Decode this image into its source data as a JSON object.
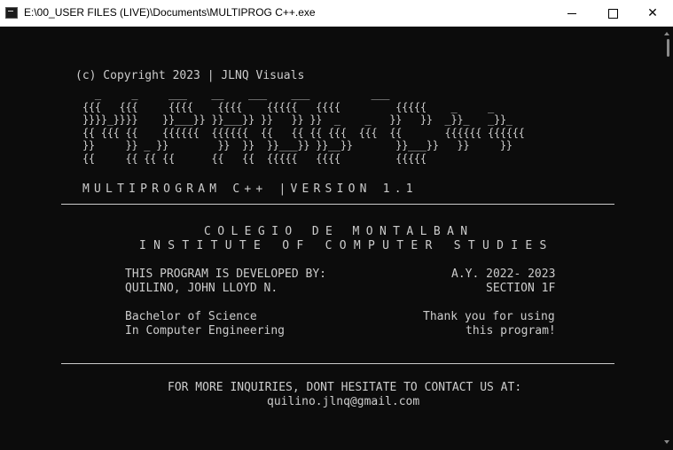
{
  "window": {
    "title": "E:\\00_USER FILES (LIVE)\\Documents\\MULTIPROG C++.exe",
    "minimize_label": "Minimize",
    "maximize_label": "Maximize",
    "close_label": "✕"
  },
  "console": {
    "copyright": "(c) Copyright 2023 | JLNQ Visuals",
    "ascii_logo": "  _     _     ___    __    ___    ___          ___\n{{{   {{{     {{{{    {{{{    {{{{{   {{{{         {{{{{    _     _\n}}}}_}}}}    }}___}} }}___}} }}   }} }}  _    _   }}   }}  _}}_   _}}_\n{{ {{{ {{    {{{{{{  {{{{{{  {{   {{ {{ {{{  {{{  {{       {{{{{{ {{{{{{\n}}     }} _ }}        }}  }}  }}___}} }}__}}       }}___}}   }}     }}\n{{     {{ {{ {{      {{   {{  {{{{{   {{{{         {{{{{",
    "program_line": "MULTIPROGRAM C++ |VERSION 1.1",
    "school": "COLEGIO DE MONTALBAN",
    "institute": "INSTITUTE OF COMPUTER STUDIES",
    "developed_by_label": "THIS PROGRAM IS DEVELOPED BY:",
    "developer_name": "QUILINO, JOHN LLOYD N.",
    "academic_year": "A.Y. 2022- 2023",
    "section": "SECTION 1F",
    "degree_line1": "Bachelor of Science",
    "degree_line2": "In Computer Engineering",
    "thanks_line1": "Thank you for using",
    "thanks_line2": "this program!",
    "inquiries": "FOR MORE INQUIRIES, DONT HESITATE TO CONTACT US AT:",
    "email": "quilino.jlnq@gmail.com"
  },
  "colors": {
    "background": "#0c0c0c",
    "text": "#cccccc",
    "titlebar": "#ffffff"
  }
}
